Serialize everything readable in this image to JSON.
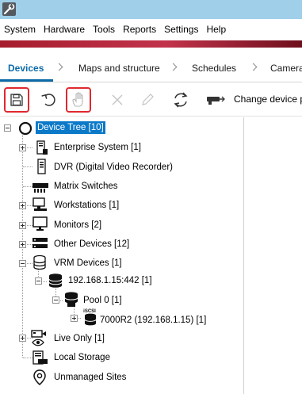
{
  "menu": [
    "System",
    "Hardware",
    "Tools",
    "Reports",
    "Settings",
    "Help"
  ],
  "tabs": [
    {
      "label": "Devices",
      "active": true
    },
    {
      "label": "Maps and structure",
      "active": false
    },
    {
      "label": "Schedules",
      "active": false
    },
    {
      "label": "Camera",
      "active": false
    }
  ],
  "toolbar": {
    "change_device_label": "Change device p"
  },
  "tree": {
    "root": "Device Tree [10]",
    "items": [
      {
        "label": "Enterprise System [1]",
        "icon": "enterprise-system-icon",
        "expandable": true
      },
      {
        "label": "DVR (Digital Video Recorder)",
        "icon": "dvr-icon",
        "expandable": false
      },
      {
        "label": "Matrix Switches",
        "icon": "matrix-switch-icon",
        "expandable": false
      },
      {
        "label": "Workstations [1]",
        "icon": "workstation-icon",
        "expandable": true
      },
      {
        "label": "Monitors [2]",
        "icon": "monitor-icon",
        "expandable": true
      },
      {
        "label": "Other Devices [12]",
        "icon": "other-devices-icon",
        "expandable": true
      },
      {
        "label": "VRM Devices [1]",
        "icon": "vrm-database-icon",
        "expandable": true,
        "expanded": true
      },
      {
        "label": "192.168.1.15:442 [1]",
        "icon": "vrm-server-icon",
        "expandable": true,
        "expanded": true
      },
      {
        "label": "Pool 0 [1]",
        "icon": "pool-icon",
        "expandable": true,
        "expanded": true
      },
      {
        "label": "7000R2 (192.168.1.15) [1]",
        "icon": "iscsi-storage-icon",
        "icon_text": "iSCSI",
        "expandable": true
      },
      {
        "label": "Live Only [1]",
        "icon": "live-only-icon",
        "expandable": true
      },
      {
        "label": "Local Storage",
        "icon": "local-storage-icon",
        "expandable": false
      },
      {
        "label": "Unmanaged Sites",
        "icon": "location-pin-icon",
        "expandable": false
      }
    ]
  },
  "colors": {
    "titlebar": "#9fcfe9",
    "accent_stripe": "#a61c2d",
    "active_tab": "#0b6aa8",
    "selection": "#0b79c8",
    "highlight_box": "#e0282f"
  }
}
